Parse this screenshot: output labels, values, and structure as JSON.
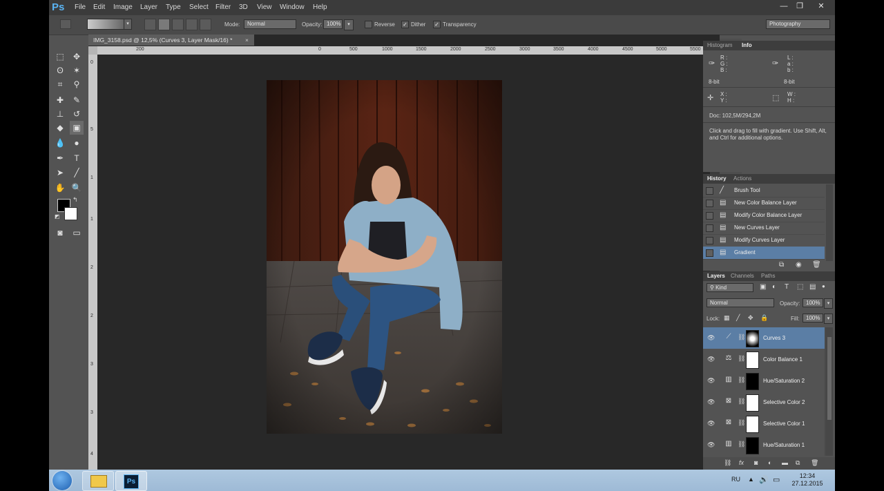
{
  "app": {
    "logo": "Ps",
    "menu": [
      "File",
      "Edit",
      "Image",
      "Layer",
      "Type",
      "Select",
      "Filter",
      "3D",
      "View",
      "Window",
      "Help"
    ],
    "window_controls": {
      "minimize": "minimize-icon",
      "restore": "restore-icon",
      "close": "close-icon"
    }
  },
  "options_bar": {
    "mode_label": "Mode:",
    "mode_value": "Normal",
    "opacity_label": "Opacity:",
    "opacity_value": "100%",
    "reverse_label": "Reverse",
    "reverse_checked": false,
    "dither_label": "Dither",
    "dither_checked": true,
    "transparency_label": "Transparency",
    "transparency_checked": true,
    "workspace": "Photography"
  },
  "document": {
    "tab_title": "IMG_3158.psd @ 12,5% (Curves 3, Layer Mask/16) *",
    "ruler_h_labels": [
      "200",
      "0",
      "200",
      "500",
      "1000",
      "1500",
      "2000",
      "2500",
      "3000",
      "3500",
      "4000",
      "4500",
      "5000",
      "5500"
    ],
    "ruler_v_labels": [
      "0",
      "5",
      "1",
      "1",
      "2",
      "2",
      "3",
      "3",
      "4",
      "4",
      "5",
      "5",
      "6"
    ]
  },
  "info_panel": {
    "tabs": [
      "Histogram",
      "Info"
    ],
    "active_tab": "Info",
    "rgb_labels": [
      "R :",
      "G :",
      "B :"
    ],
    "lab_labels": [
      "L :",
      "a :",
      "b :"
    ],
    "bitdepth_left": "8-bit",
    "bitdepth_right": "8-bit",
    "xy_labels": [
      "X :",
      "Y :"
    ],
    "wh_labels": [
      "W :",
      "H :"
    ],
    "doc_size": "Doc: 102,5M/294,2M",
    "hint": "Click and drag to fill with gradient.  Use Shift, Alt, and Ctrl for additional options."
  },
  "history_panel": {
    "tabs": [
      "History",
      "Actions"
    ],
    "active_tab": "History",
    "items": [
      {
        "label": "Brush Tool",
        "icon": "brush-icon",
        "active": false
      },
      {
        "label": "New Color Balance Layer",
        "icon": "document-icon",
        "active": false
      },
      {
        "label": "Modify Color Balance Layer",
        "icon": "document-icon",
        "active": false
      },
      {
        "label": "New Curves Layer",
        "icon": "document-icon",
        "active": false
      },
      {
        "label": "Modify Curves Layer",
        "icon": "document-icon",
        "active": false
      },
      {
        "label": "Gradient",
        "icon": "document-icon",
        "active": true
      }
    ]
  },
  "layers_panel": {
    "tabs": [
      "Layers",
      "Channels",
      "Paths"
    ],
    "active_tab": "Layers",
    "filter_kind": "Kind",
    "blend_mode": "Normal",
    "opacity_label": "Opacity:",
    "opacity_value": "100%",
    "lock_label": "Lock:",
    "fill_label": "Fill:",
    "fill_value": "100%",
    "layers": [
      {
        "name": "Curves 3",
        "icon": "curves-icon",
        "mask": "radial",
        "active": true
      },
      {
        "name": "Color Balance 1",
        "icon": "balance-icon",
        "mask": "white",
        "active": false
      },
      {
        "name": "Hue/Saturation 2",
        "icon": "hue-saturation-icon",
        "mask": "black-figure",
        "active": false
      },
      {
        "name": "Selective Color 2",
        "icon": "selective-color-icon",
        "mask": "white",
        "active": false
      },
      {
        "name": "Selective Color 1",
        "icon": "selective-color-icon",
        "mask": "white",
        "active": false
      },
      {
        "name": "Hue/Saturation 1",
        "icon": "hue-saturation-icon",
        "mask": "black-figure",
        "active": false
      }
    ]
  },
  "taskbar": {
    "language": "RU",
    "time": "12:34",
    "date": "27.12.2015"
  },
  "colors": {
    "accent_selection": "#5b7ea5",
    "ps_blue": "#5ab3f2",
    "panel_bg": "#535353"
  }
}
